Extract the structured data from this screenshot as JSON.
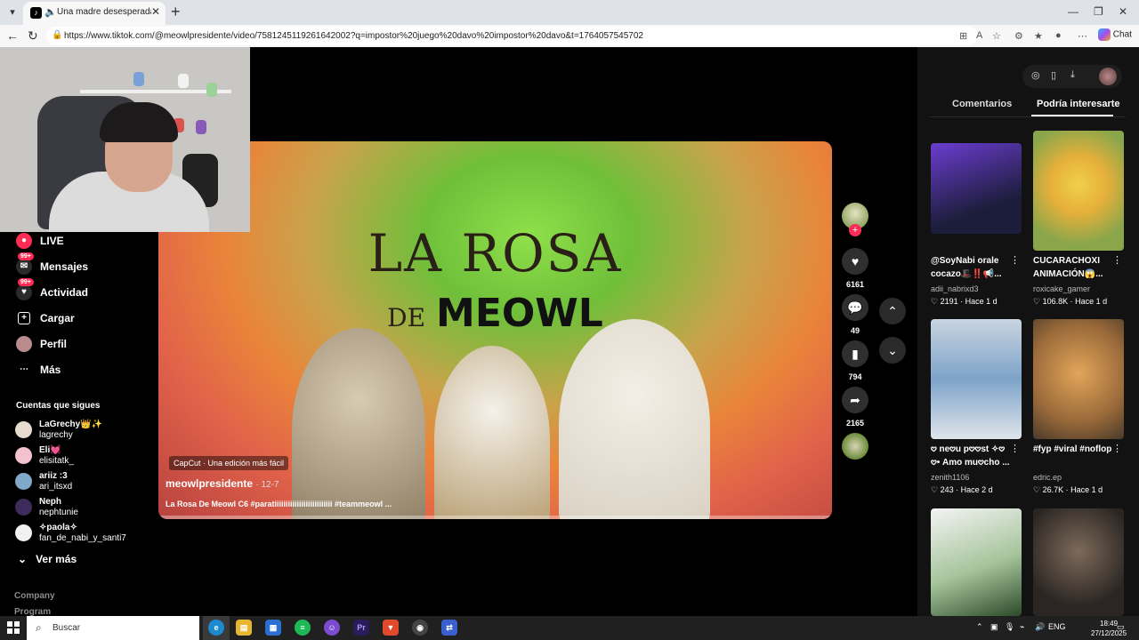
{
  "browser": {
    "tab_title": "Una madre desesperada: La h",
    "tab_favicon": "tiktok-icon",
    "url": "https://www.tiktok.com/@meowlpresidente/video/7581245119261642002?q=impostor%20juego%20davo%20impostor%20davo&t=1764057545702",
    "chat_label": "Chat"
  },
  "sidebar": {
    "items": [
      {
        "label": "LIVE",
        "icon": "live-icon",
        "badge": ""
      },
      {
        "label": "Mensajes",
        "icon": "messages-icon",
        "badge": "99+"
      },
      {
        "label": "Actividad",
        "icon": "activity-icon",
        "badge": "99+"
      },
      {
        "label": "Cargar",
        "icon": "upload-icon",
        "badge": ""
      },
      {
        "label": "Perfil",
        "icon": "profile-icon",
        "badge": ""
      },
      {
        "label": "Más",
        "icon": "more-icon",
        "badge": ""
      }
    ],
    "following_title": "Cuentas que sigues",
    "following": [
      {
        "name": "LaGrechy👑✨",
        "user": "lagrechy"
      },
      {
        "name": "Eli💓",
        "user": "elisitatk_"
      },
      {
        "name": "ariiz :3",
        "user": "ari_itsxd"
      },
      {
        "name": "Neph",
        "user": "nephtunie"
      },
      {
        "name": "✧paola✧",
        "user": "fan_de_nabi_y_santi7"
      }
    ],
    "see_more": "Ver más",
    "company": "Company",
    "program": "Program"
  },
  "video": {
    "title_line1": "LA ROSA",
    "title_de": "DE",
    "title_meowl": "MEOWL",
    "capcut": "CapCut · Una edición más fácil",
    "author": "meowlpresidente",
    "date": "· 12-7",
    "description": "La Rosa De Meowl C6 #paratiiiiiiiiiiiiiiiiiiiiiiiiii #teammeowl ...",
    "progress": 0.0
  },
  "actions": {
    "likes": "6161",
    "comments": "49",
    "saves": "794",
    "shares": "2165"
  },
  "right_panel": {
    "tabs": [
      "Comentarios",
      "Podría interesarte"
    ],
    "active_tab": 1,
    "cards": [
      {
        "title": "@SoyNabi orale cocazo🎩‼️📢...",
        "user": "adii_nabrixd3",
        "likes": "2191",
        "age": "Hace 1 d"
      },
      {
        "title": "CUCARACHOXI ANIMACIÓN😱...",
        "user": "roxicake_gamer",
        "likes": "106.8K",
        "age": "Hace 1 d"
      },
      {
        "title": "𖹭 ne𖹭u p𖹭𖹭st ✧𖹭 𖹭• Amo mu𖹭cho ...",
        "user": "zenith1106",
        "likes": "243",
        "age": "Hace 2 d"
      },
      {
        "title": "#fyp #viral #noflop",
        "user": "edric.ep",
        "likes": "26.7K",
        "age": "Hace 1 d"
      }
    ]
  },
  "taskbar": {
    "search_placeholder": "Buscar",
    "lang": "ENG",
    "time": "18:49",
    "date": "27/12/2025"
  },
  "colors": {
    "accent": "#fe2c55",
    "background": "#000000",
    "panel": "#121212"
  }
}
